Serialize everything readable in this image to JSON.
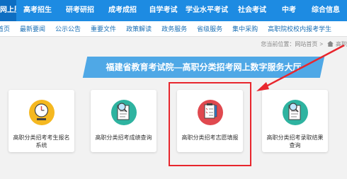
{
  "topnav": {
    "items": [
      "网上服务",
      "高考招生",
      "研考研招",
      "成考成招",
      "自学考试",
      "学业水平考试",
      "社会考试",
      "中考",
      "综合信息"
    ]
  },
  "subnav": {
    "items": [
      "首页",
      "最新要闻",
      "公示公告",
      "重要文件",
      "政策解读",
      "政务服务",
      "省级服务",
      "集中采购",
      "高职院校校内报考学生"
    ]
  },
  "breadcrumb": {
    "label": "您当前位置：",
    "site": "网站首页",
    "current": "高职"
  },
  "banner": {
    "title": "福建省教育考试院—高职分类招考网上数字服务大厅"
  },
  "cards": [
    {
      "label": "高职分类招考考生报名系统",
      "icon": "clock-icon",
      "color": "#f5b820"
    },
    {
      "label": "高职分类招考成绩查询",
      "icon": "document-search-icon",
      "color": "#2eb3a0"
    },
    {
      "label": "高职分类招考志愿填报",
      "icon": "checklist-pencil-icon",
      "color": "#e0494f"
    },
    {
      "label": "高职分类招考录取结果查询",
      "icon": "document-search-icon",
      "color": "#2eb3a0"
    }
  ],
  "colors": {
    "nav_bg": "#1d8be2",
    "highlight": "#e8262d",
    "banner": "#4fa8e6"
  }
}
